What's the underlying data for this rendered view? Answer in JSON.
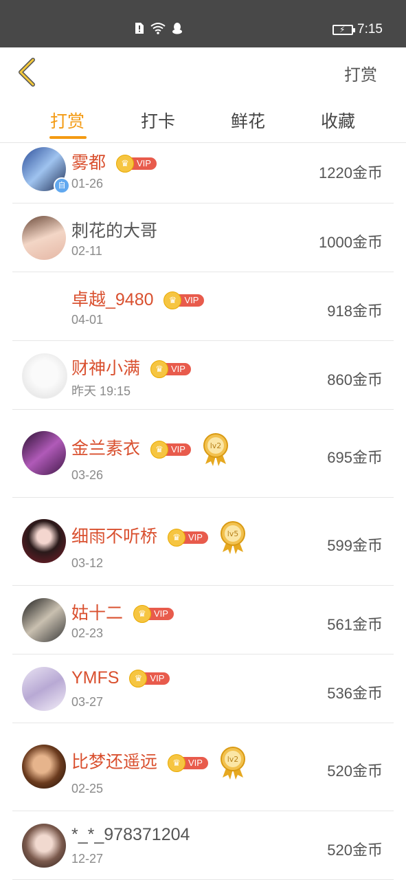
{
  "status_bar": {
    "time": "7:15"
  },
  "header": {
    "action_label": "打赏"
  },
  "tabs": [
    {
      "label": "打赏",
      "active": true
    },
    {
      "label": "打卡",
      "active": false
    },
    {
      "label": "鲜花",
      "active": false
    },
    {
      "label": "收藏",
      "active": false
    }
  ],
  "rewards": [
    {
      "name": "雾都",
      "vip": "VIP",
      "date": "01-26",
      "amount": "1220金币",
      "level": null,
      "badge": "自"
    },
    {
      "name": "刺花的大哥",
      "vip": null,
      "date": "02-11",
      "amount": "1000金币",
      "level": null
    },
    {
      "name": "卓越_9480",
      "vip": "VIP",
      "date": "04-01",
      "amount": "918金币",
      "level": null
    },
    {
      "name": "财神小满",
      "vip": "VIP",
      "date": "昨天 19:15",
      "amount": "860金币",
      "level": null
    },
    {
      "name": "金兰素衣",
      "vip": "VIP",
      "date": "03-26",
      "amount": "695金币",
      "level": "lv2"
    },
    {
      "name": "细雨不听桥",
      "vip": "VIP",
      "date": "03-12",
      "amount": "599金币",
      "level": "lv5"
    },
    {
      "name": "姑十二",
      "vip": "VIP",
      "date": "02-23",
      "amount": "561金币",
      "level": null
    },
    {
      "name": "YMFS",
      "vip": "VIP",
      "date": "03-27",
      "amount": "536金币",
      "level": null
    },
    {
      "name": "比梦还遥远",
      "vip": "VIP",
      "date": "02-25",
      "amount": "520金币",
      "level": "lv2"
    },
    {
      "name": "*_*_978371204",
      "vip": null,
      "date": "12-27",
      "amount": "520金币",
      "level": null
    }
  ],
  "colors": {
    "accent": "#f39a12",
    "vip_name": "#d9502f",
    "vip_tag": "#e85b4c"
  }
}
